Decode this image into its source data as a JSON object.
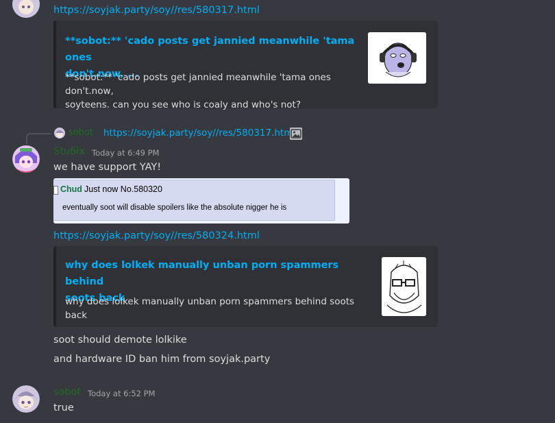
{
  "messages": [
    {
      "link": "https://soyjak.party/soy//res/580317.html",
      "embed": {
        "title": "**sobot:** 'cado posts get jannied meanwhile 'tama ones don't.now, ...",
        "title_line1": "**sobot:** 'cado posts get jannied meanwhile 'tama ones",
        "title_line2": "don't.now, ...",
        "desc_line1": "**sobot:** 'cado posts get jannied meanwhile 'tama ones don't.now,",
        "desc_line2": "soyteens. can you see who is coaly and who's not?"
      }
    },
    {
      "reply": {
        "username": "sobot",
        "text": "https://soyjak.party/soy//res/580317.html"
      },
      "username": "Stu6ix",
      "username_color": "#1f6b1f",
      "timestamp": "Today at 6:49 PM",
      "text": "we have support YAY!",
      "screenshot": {
        "name": "Chud",
        "meta": "Just now No.580320",
        "body": "eventually soot will disable spoilers like the absolute nigger he is"
      },
      "link": "https://soyjak.party/soy//res/580324.html",
      "embed": {
        "title_line1": "why does lolkek manually unban porn spammers behind",
        "title_line2": "soots back",
        "desc": "why does lolkek manually unban porn spammers behind soots back"
      },
      "lines": [
        "soot should demote  lolkike",
        "and hardware ID ban him from soyjak.party"
      ]
    },
    {
      "username": "sobot",
      "username_color": "#1f6b1f",
      "timestamp": "Today at 6:52 PM",
      "text": "true"
    }
  ],
  "colors": {
    "background": "#36393f",
    "embed_bg": "#2f3136",
    "link": "#00aff4"
  }
}
